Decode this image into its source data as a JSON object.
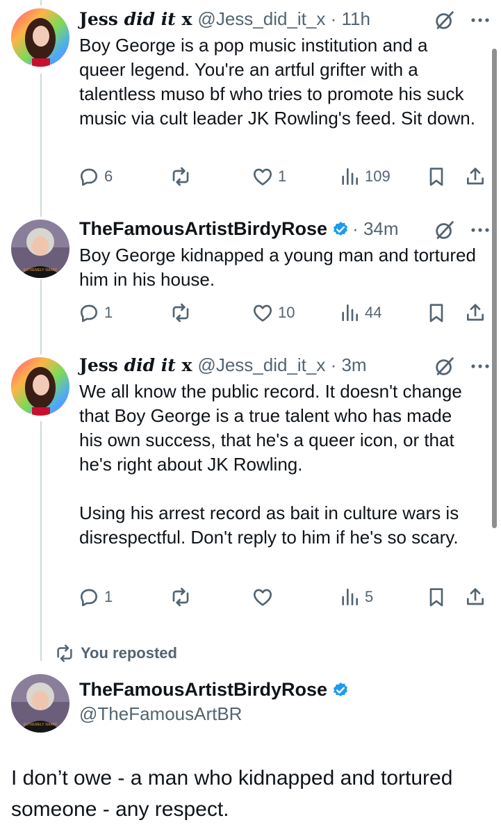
{
  "tweets": [
    {
      "name_plain": "Jess ",
      "name_italic": "did it",
      "name_tail": " x",
      "handle_time": "@Jess_did_it_x · 11h",
      "text": "Boy George is a pop music institution and a queer legend. You're an artful grifter with a talentless muso bf who tries to promote his suck music via cult leader JK Rowling's feed. Sit down.",
      "replies": "6",
      "reposts": "",
      "likes": "1",
      "views": "109"
    },
    {
      "name": "TheFamousArtistBirdyRose",
      "handle_time": "· 34m",
      "text": "Boy George kidnapped a young man and tortured him in his house.",
      "replies": "1",
      "reposts": "",
      "likes": "10",
      "views": "44"
    },
    {
      "name_plain": "Jess ",
      "name_italic": "did it",
      "name_tail": " x",
      "handle_time": "@Jess_did_it_x · 3m",
      "text": "We all know the public record. It doesn't change that Boy George is a true talent who has made his own success, that he's a queer icon, or that he's right about JK Rowling.\n\nUsing his arrest record as bait in culture wars is disrespectful. Don't reply to him if he's so scary.",
      "replies": "1",
      "reposts": "",
      "likes": "",
      "views": "5"
    }
  ],
  "repost_notice": "You reposted",
  "main_tweet": {
    "name": "TheFamousArtistBirdyRose",
    "handle": "@TheFamousArtBR",
    "text": "I don’t owe - a man who kidnapped and tortured someone - any respect."
  },
  "colors": {
    "verified_blue": "#1d9bf0",
    "muted": "#536471",
    "text": "#0f1419",
    "thread_line": "#cfd9de"
  },
  "icons": [
    "reply-icon",
    "repost-icon",
    "like-icon",
    "views-icon",
    "bookmark-icon",
    "share-icon",
    "verified-icon",
    "grok-icon",
    "more-icon"
  ]
}
